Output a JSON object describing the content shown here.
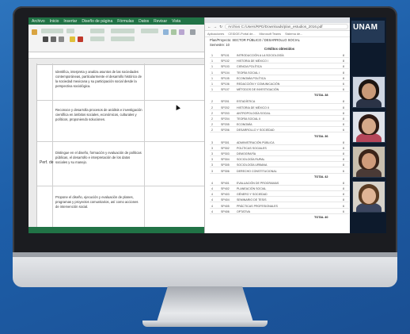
{
  "excel": {
    "menu": [
      "Archivo",
      "Inicio",
      "Insertar",
      "Diseño de página",
      "Fórmulas",
      "Datos",
      "Revisar",
      "Vista"
    ],
    "rows": [
      {
        "text": "Identifica, interpreta y analiza asuntos de las sociedades contemporáneas, particularmente el desarrollo histórico de la sociedad mexicana y su participación social desde la perspectiva sociológica."
      },
      {
        "text": "Reconoce y desarrolla procesos de análisis e investigación científica en ámbitos sociales, económicos, culturales y políticos, proponiendo soluciones."
      },
      {
        "text": "Distingue en el diseño, formación y evaluación de políticas públicas, el desarrollo e interpretación de los datos sociales y su manejo.",
        "side": "Perf. de"
      },
      {
        "text": "Propone el diseño, ejecución y evaluación de planes, programas y proyectos comunitarios, así como acciones de intervención social."
      }
    ]
  },
  "pdf": {
    "address": "Archivo  C:/Users/RPD/Downloads/plan_estudios_2016.pdf",
    "bookmarks": [
      "Aplicaciones",
      "CEIDGE-Portal de...",
      "Microsoft Teams",
      "Sistema de..."
    ],
    "header": [
      "Plan/Proyecto: SECTOR PÚBLICO / DESARROLLO SOCIAL",
      "Semestre: 10"
    ],
    "table_title": "Créditos obtenidos",
    "rows": [
      [
        "1",
        "SP101",
        "INTRODUCCIÓN A LA SOCIOLOGÍA",
        "8"
      ],
      [
        "1",
        "SP102",
        "HISTORIA DE MÉXICO I",
        "8"
      ],
      [
        "1",
        "SP103",
        "CIENCIA POLÍTICA",
        "8"
      ],
      [
        "1",
        "SP104",
        "TEORÍA SOCIAL I",
        "8"
      ],
      [
        "1",
        "SP105",
        "ECONOMÍA POLÍTICA",
        "8"
      ],
      [
        "1",
        "SP106",
        "REDACCIÓN Y COMUNICACIÓN",
        "6"
      ],
      [
        "1",
        "SP107",
        "MÉTODOS DE INVESTIGACIÓN",
        "6"
      ],
      [
        "2",
        "SP201",
        "ESTADÍSTICA",
        "8"
      ],
      [
        "2",
        "SP202",
        "HISTORIA DE MÉXICO II",
        "8"
      ],
      [
        "2",
        "SP203",
        "ANTROPOLOGÍA SOCIAL",
        "8"
      ],
      [
        "2",
        "SP204",
        "TEORÍA SOCIAL II",
        "8"
      ],
      [
        "2",
        "SP205",
        "ECONOMÍA",
        "8"
      ],
      [
        "2",
        "SP206",
        "DESARROLLO Y SOCIEDAD",
        "6"
      ],
      [
        "3",
        "SP301",
        "ADMINISTRACIÓN PÚBLICA",
        "8"
      ],
      [
        "3",
        "SP302",
        "POLÍTICAS SOCIALES",
        "8"
      ],
      [
        "3",
        "SP303",
        "DEMOGRAFÍA",
        "8"
      ],
      [
        "3",
        "SP304",
        "SOCIOLOGÍA RURAL",
        "8"
      ],
      [
        "3",
        "SP305",
        "SOCIOLOGÍA URBANA",
        "8"
      ],
      [
        "3",
        "SP306",
        "DERECHO CONSTITUCIONAL",
        "6"
      ],
      [
        "4",
        "SP401",
        "EVALUACIÓN DE PROGRAMAS",
        "8"
      ],
      [
        "4",
        "SP402",
        "PLANEACIÓN SOCIAL",
        "8"
      ],
      [
        "4",
        "SP403",
        "GÉNERO Y SOCIEDAD",
        "8"
      ],
      [
        "4",
        "SP404",
        "SEMINARIO DE TESIS",
        "8"
      ],
      [
        "4",
        "SP405",
        "PRÁCTICAS PROFESIONALES",
        "6"
      ],
      [
        "4",
        "SP406",
        "OPTATIVA",
        "6"
      ]
    ],
    "totals": [
      "TOTAL  38",
      "TOTAL  36",
      "TOTAL  42",
      "TOTAL  40"
    ]
  },
  "video": {
    "logo": "UNAM"
  }
}
